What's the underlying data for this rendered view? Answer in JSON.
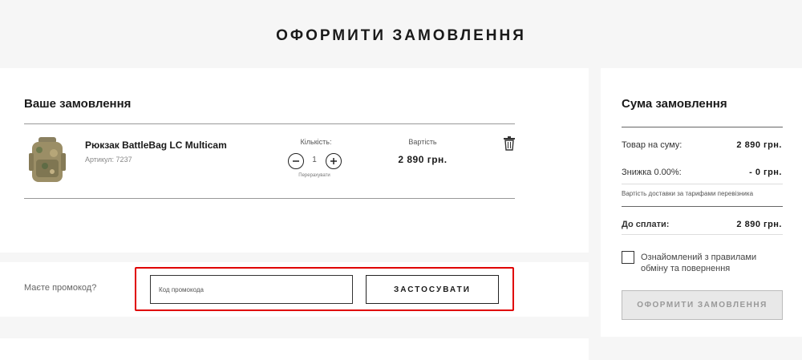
{
  "page": {
    "title": "ОФОРМИТИ ЗАМОВЛЕННЯ"
  },
  "order": {
    "title": "Ваше замовлення",
    "item": {
      "name": "Рюкзак BattleBag LC Multicam",
      "sku": "Артикул: 7237",
      "qty_label": "Кількість:",
      "qty": "1",
      "recalc": "Перерахувати",
      "cost_label": "Вартість",
      "cost": "2 890 грн.",
      "icons": {
        "minus": "minus-icon",
        "plus": "plus-icon",
        "delete": "trash-icon"
      }
    }
  },
  "promo": {
    "question": "Маєте промокод?",
    "placeholder": "Код промокода",
    "value": "",
    "apply": "ЗАСТОСУВАТИ"
  },
  "summary": {
    "title": "Сума замовлення",
    "goods_label": "Товар на суму:",
    "goods_value": "2 890 грн.",
    "discount_label": "Знижка 0.00%:",
    "discount_value": "- 0 грн.",
    "delivery_note": "Вартість доставки за тарифами перевізника",
    "total_label": "До сплати:",
    "total_value": "2 890 грн.",
    "agree_text": "Ознайомлений з правилами обміну та повернення",
    "agree_checked": false,
    "submit": "ОФОРМИТИ ЗАМОВЛЕННЯ"
  },
  "colors": {
    "highlight": "#e00000",
    "divider": "#999999",
    "submit_disabled_bg": "#e8e8e8"
  }
}
